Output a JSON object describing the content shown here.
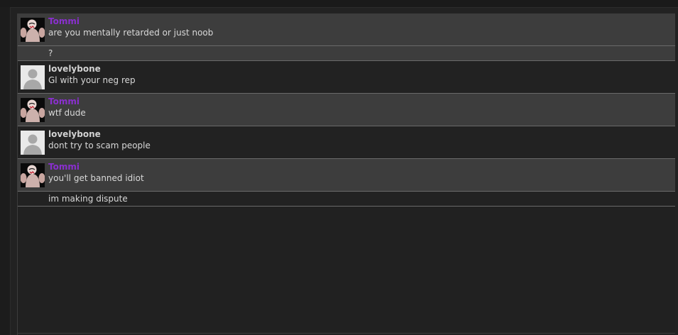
{
  "messages": [
    {
      "user": "Tommi",
      "avatar": "tommi-avatar-icon",
      "text": "are you mentally retarded or just noob",
      "followups": [
        "?"
      ]
    },
    {
      "user": "lovelybone",
      "avatar": "default-user-avatar-icon",
      "text": "Gl with your neg rep",
      "followups": []
    },
    {
      "user": "Tommi",
      "avatar": "tommi-avatar-icon",
      "text": "wtf dude",
      "followups": []
    },
    {
      "user": "lovelybone",
      "avatar": "default-user-avatar-icon",
      "text": "dont try to scam people",
      "followups": []
    },
    {
      "user": "Tommi",
      "avatar": "tommi-avatar-icon",
      "text": "you'll get banned idiot",
      "followups": [
        "im making dispute"
      ]
    }
  ],
  "colors": {
    "tommi_name": "#8a2fcf",
    "lovelybone_name": "#d2d2d2",
    "message_text": "#d8d8d8",
    "row_alt": "#3d3d3d",
    "row_base": "#222222"
  }
}
